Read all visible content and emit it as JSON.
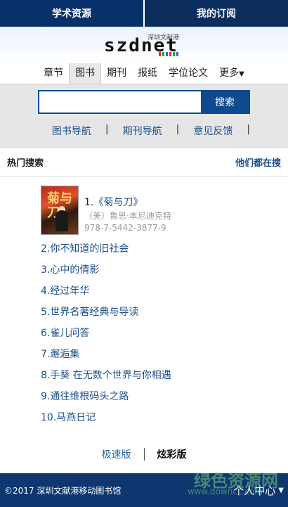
{
  "top_tabs": [
    {
      "label": "学术资源"
    },
    {
      "label": "我的订阅"
    }
  ],
  "logo": {
    "text": "szdnet",
    "subtitle": "深圳文献港"
  },
  "categories": [
    {
      "label": "章节"
    },
    {
      "label": "图书"
    },
    {
      "label": "期刊"
    },
    {
      "label": "报纸"
    },
    {
      "label": "学位论文"
    },
    {
      "label": "更多",
      "icon": "caret-down-icon"
    }
  ],
  "search": {
    "value": "",
    "placeholder": "",
    "button_label": "搜索"
  },
  "sub_links": [
    {
      "label": "图书导航"
    },
    {
      "label": "期刊导航"
    },
    {
      "label": "意见反馈"
    }
  ],
  "hot_search": {
    "title": "热门搜索",
    "link_label": "他们都在搜"
  },
  "featured_book": {
    "rank": "1.",
    "title": "《菊与刀》",
    "author": "（美）鲁思·本尼迪克特",
    "isbn": "978-7-5442-3877-9",
    "cover_title": "菊与刀"
  },
  "hot_list": [
    {
      "label": "2.你不知道的旧社会"
    },
    {
      "label": "3.心中的倩影"
    },
    {
      "label": "4.经过年华"
    },
    {
      "label": "5.世界名著经典与导读"
    },
    {
      "label": "6.雀儿问答"
    },
    {
      "label": "7.邂逅集"
    },
    {
      "label": "8.手葵 在无数个世界与你相遇"
    },
    {
      "label": "9.通往维根码头之路"
    },
    {
      "label": "10.马燕日记"
    }
  ],
  "versions": {
    "fast": "极速版",
    "color": "炫彩版"
  },
  "footer": {
    "copyright": "©2017 深圳文献港移动图书馆",
    "user_center": "个人中心"
  },
  "watermark": {
    "main": "绿色资源网",
    "sub": "www.downcc.com"
  },
  "colors": {
    "primary": "#0d4a8f",
    "dark_nav": "#08306a",
    "link": "#1d4f8c",
    "footer": "#0e3770"
  }
}
